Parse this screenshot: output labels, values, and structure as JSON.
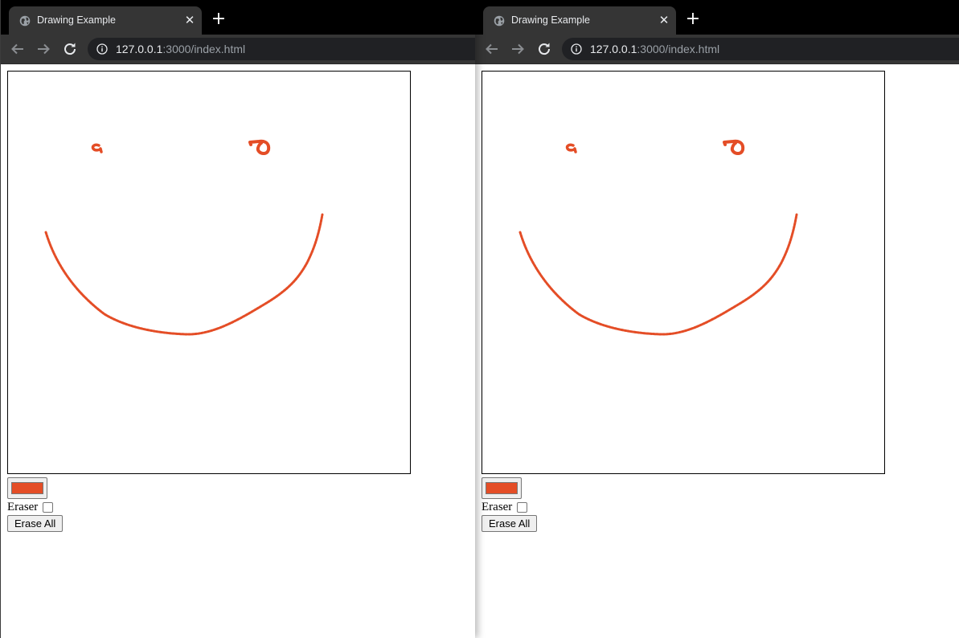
{
  "windows": [
    {
      "tab_title": "Drawing Example",
      "url_host": "127.0.0.1",
      "url_rest": ":3000/index.html",
      "color_value": "#e44d26",
      "eraser_label": "Eraser",
      "eraser_checked": false,
      "erase_all_label": "Erase All"
    },
    {
      "tab_title": "Drawing Example",
      "url_host": "127.0.0.1",
      "url_rest": ":3000/index.html",
      "color_value": "#e44d26",
      "eraser_label": "Eraser",
      "eraser_checked": false,
      "erase_all_label": "Erase All"
    }
  ],
  "colors": {
    "stroke": "#e44d26",
    "tab_strip": "#000000",
    "toolbar": "#353535",
    "omnibox": "#202124"
  },
  "icons": [
    "globe-icon",
    "close-icon",
    "plus-icon",
    "back-arrow-icon",
    "forward-arrow-icon",
    "reload-icon",
    "info-icon"
  ]
}
